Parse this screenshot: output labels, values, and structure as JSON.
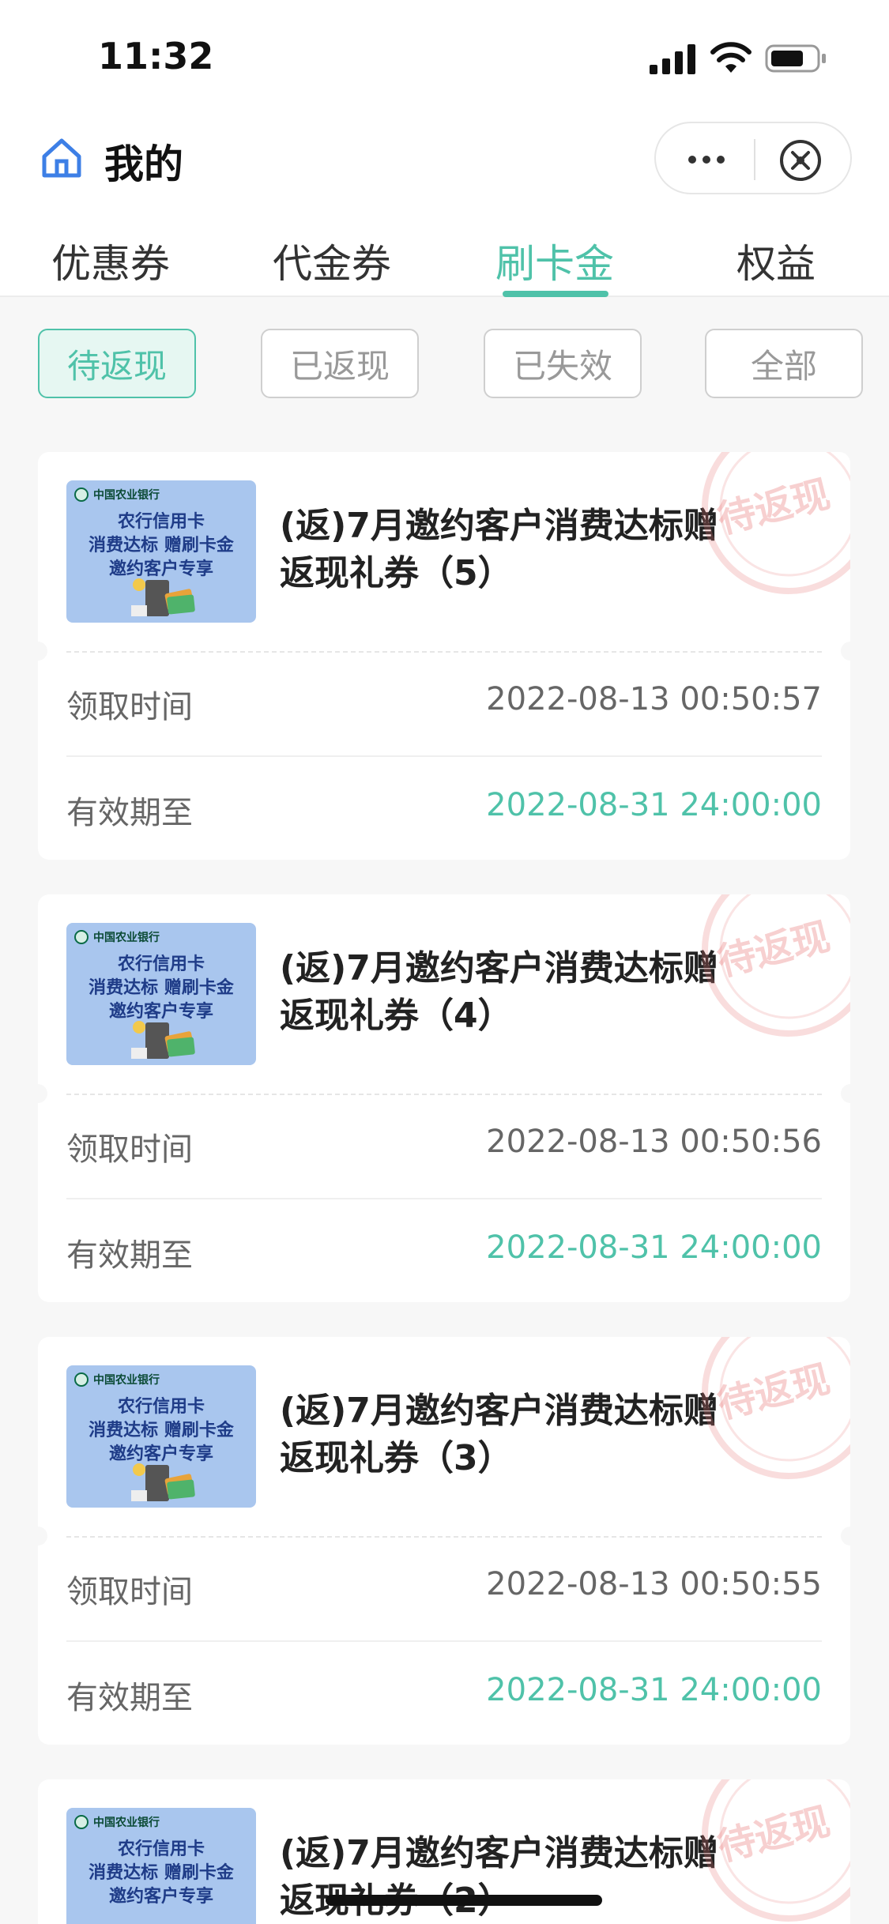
{
  "status_bar": {
    "time": "11:32"
  },
  "nav": {
    "title": "我的"
  },
  "tabs": [
    {
      "label": "优惠券",
      "active": false
    },
    {
      "label": "代金券",
      "active": false
    },
    {
      "label": "刷卡金",
      "active": true
    },
    {
      "label": "权益",
      "active": false
    }
  ],
  "filters": [
    {
      "label": "待返现",
      "active": true
    },
    {
      "label": "已返现",
      "active": false
    },
    {
      "label": "已失效",
      "active": false
    },
    {
      "label": "全部",
      "active": false
    }
  ],
  "labels": {
    "received": "领取时间",
    "valid_until": "有效期至"
  },
  "thumb": {
    "bank": "中国农业银行",
    "line1": "农行信用卡",
    "line2": "消费达标 赠刷卡金",
    "line3": "邀约客户专享"
  },
  "stamp_text": "待返现",
  "coupons": [
    {
      "title": "(返)7月邀约客户消费达标赠返现礼券（5）",
      "received": "2022-08-13 00:50:57",
      "valid_until": "2022-08-31 24:00:00"
    },
    {
      "title": "(返)7月邀约客户消费达标赠返现礼券（4）",
      "received": "2022-08-13 00:50:56",
      "valid_until": "2022-08-31 24:00:00"
    },
    {
      "title": "(返)7月邀约客户消费达标赠返现礼券（3）",
      "received": "2022-08-13 00:50:55",
      "valid_until": "2022-08-31 24:00:00"
    },
    {
      "title": "(返)7月邀约客户消费达标赠返现礼券（2）",
      "received": "",
      "valid_until": ""
    }
  ],
  "colors": {
    "accent": "#4fc2a9",
    "stamp": "#e87878",
    "thumb_bg": "#a9c6ee"
  }
}
